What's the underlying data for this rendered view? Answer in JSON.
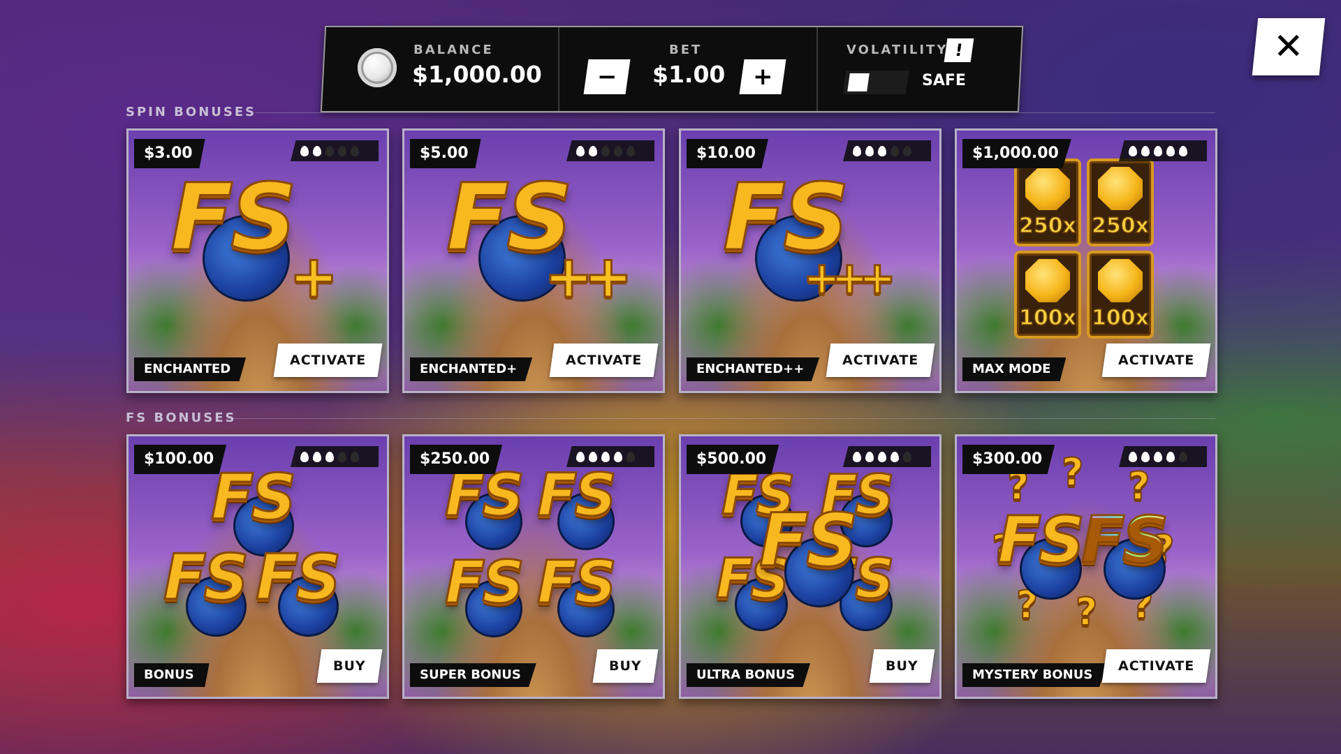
{
  "header": {
    "balance_label": "BALANCE",
    "balance_value": "$1,000.00",
    "bet_label": "BET",
    "bet_value": "$1.00",
    "decrease_label": "−",
    "increase_label": "+",
    "volatility_label": "VOLATILITY",
    "volatility_info": "!",
    "volatility_value": "SAFE"
  },
  "close_label": "✕",
  "sections": [
    {
      "title": "SPIN BONUSES",
      "cards": [
        {
          "price": "$3.00",
          "flames": 2,
          "name": "ENCHANTED",
          "action": "ACTIVATE",
          "art": "fs-plus",
          "plus": "+"
        },
        {
          "price": "$5.00",
          "flames": 2,
          "name": "ENCHANTED+",
          "action": "ACTIVATE",
          "art": "fs-plus",
          "plus": "++"
        },
        {
          "price": "$10.00",
          "flames": 3,
          "name": "ENCHANTED++",
          "action": "ACTIVATE",
          "art": "fs-plus",
          "plus": "+++"
        },
        {
          "price": "$1,000.00",
          "flames": 5,
          "name": "MAX MODE",
          "action": "ACTIVATE",
          "art": "multipliers",
          "multipliers": [
            "250x",
            "250x",
            "100x",
            "100x"
          ]
        }
      ]
    },
    {
      "title": "FS BONUSES",
      "cards": [
        {
          "price": "$100.00",
          "flames": 3,
          "name": "BONUS",
          "action": "BUY",
          "art": "fs-3"
        },
        {
          "price": "$250.00",
          "flames": 4,
          "name": "SUPER BONUS",
          "action": "BUY",
          "art": "fs-4"
        },
        {
          "price": "$500.00",
          "flames": 4,
          "name": "ULTRA BONUS",
          "action": "BUY",
          "art": "fs-5"
        },
        {
          "price": "$300.00",
          "flames": 4,
          "name": "MYSTERY BONUS",
          "action": "ACTIVATE",
          "art": "mystery"
        }
      ]
    }
  ],
  "art_text": {
    "fs": "FS",
    "question": "?"
  },
  "colors": {
    "panel": "#0d0d0d",
    "accent_gold": "#f8b820",
    "button": "#ffffff"
  }
}
